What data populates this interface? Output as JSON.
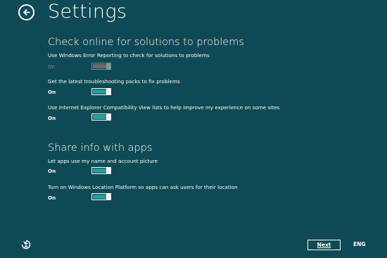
{
  "header": {
    "title": "Settings"
  },
  "sections": [
    {
      "title": "Check online for solutions to problems",
      "items": [
        {
          "label": "Use Windows Error Reporting to check for solutions to problems",
          "state": "On",
          "enabled": false
        },
        {
          "label": "Get the latest troubleshooting packs to fix problems",
          "state": "On",
          "enabled": true
        },
        {
          "label": "Use Internet Explorer Compatibility View lists to help improve my experience on some sites",
          "state": "On",
          "enabled": true
        }
      ]
    },
    {
      "title": "Share info with apps",
      "items": [
        {
          "label": "Let apps use my name and account picture",
          "state": "On",
          "enabled": true
        },
        {
          "label": "Turn on Windows Location Platform so apps can ask users for their location",
          "state": "On",
          "enabled": true
        }
      ]
    }
  ],
  "footer": {
    "next_label": "Next",
    "language": "ENG"
  },
  "colors": {
    "background": "#0e4a55",
    "accent": "#21a19a",
    "disabled_text": "#6d8e94"
  },
  "icons": {
    "back": "back-arrow-icon",
    "ease_of_access": "ease-of-access-icon"
  }
}
